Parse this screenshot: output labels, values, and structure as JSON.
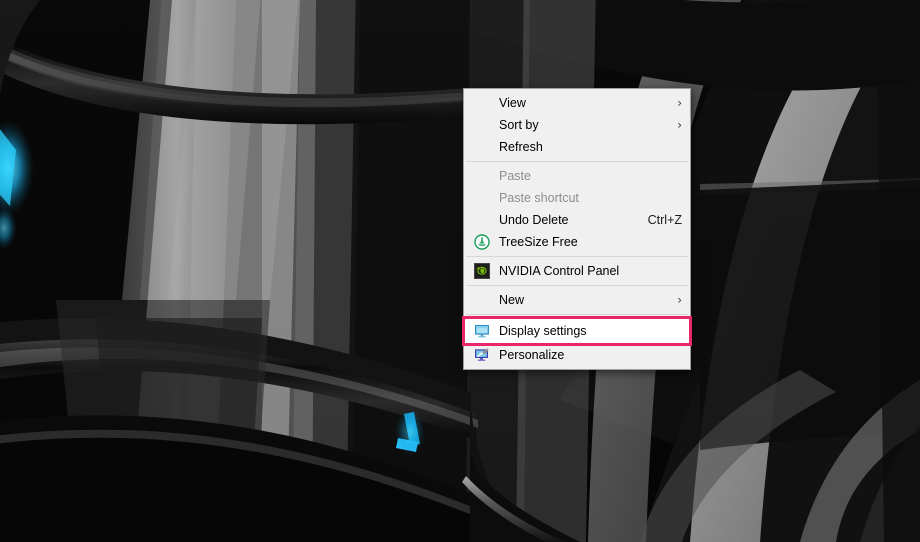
{
  "desktop": {
    "name": "windows-desktop",
    "wallpaper_description": "abstract dark glossy curved panels with gray bands and cyan edge glow",
    "colors": {
      "bg_black": "#050505",
      "panel_dark": "#141414",
      "panel_mid": "#3a3a3a",
      "panel_light": "#9a9a9a",
      "panel_lighter": "#c9c9c9",
      "cyan_accent": "#14b4e8",
      "cyan_glow": "#29d2ff"
    }
  },
  "context_menu": {
    "name": "desktop-context-menu",
    "background": "#f0f0f0",
    "border": "#9e9e9e",
    "highlight_color": "#e8266b",
    "items": [
      {
        "id": "view",
        "label": "View",
        "icon": "",
        "accel": "",
        "submenu": true,
        "disabled": false,
        "highlighted": false
      },
      {
        "id": "sort-by",
        "label": "Sort by",
        "icon": "",
        "accel": "",
        "submenu": true,
        "disabled": false,
        "highlighted": false
      },
      {
        "id": "refresh",
        "label": "Refresh",
        "icon": "",
        "accel": "",
        "submenu": false,
        "disabled": false,
        "highlighted": false
      },
      {
        "id": "separator-1",
        "label": "",
        "icon": "",
        "accel": "",
        "submenu": false,
        "disabled": false,
        "highlighted": false
      },
      {
        "id": "paste",
        "label": "Paste",
        "icon": "",
        "accel": "",
        "submenu": false,
        "disabled": true,
        "highlighted": false
      },
      {
        "id": "paste-shortcut",
        "label": "Paste shortcut",
        "icon": "",
        "accel": "",
        "submenu": false,
        "disabled": true,
        "highlighted": false
      },
      {
        "id": "undo-delete",
        "label": "Undo Delete",
        "icon": "",
        "accel": "Ctrl+Z",
        "submenu": false,
        "disabled": false,
        "highlighted": false
      },
      {
        "id": "treesize-free",
        "label": "TreeSize Free",
        "icon": "treesize-icon",
        "accel": "",
        "submenu": false,
        "disabled": false,
        "highlighted": false
      },
      {
        "id": "separator-2",
        "label": "",
        "icon": "",
        "accel": "",
        "submenu": false,
        "disabled": false,
        "highlighted": false
      },
      {
        "id": "nvidia-control-panel",
        "label": "NVIDIA Control Panel",
        "icon": "nvidia-icon",
        "accel": "",
        "submenu": false,
        "disabled": false,
        "highlighted": false
      },
      {
        "id": "separator-3",
        "label": "",
        "icon": "",
        "accel": "",
        "submenu": false,
        "disabled": false,
        "highlighted": false
      },
      {
        "id": "new",
        "label": "New",
        "icon": "",
        "accel": "",
        "submenu": true,
        "disabled": false,
        "highlighted": false
      },
      {
        "id": "separator-4",
        "label": "",
        "icon": "",
        "accel": "",
        "submenu": false,
        "disabled": false,
        "highlighted": false
      },
      {
        "id": "display-settings",
        "label": "Display settings",
        "icon": "monitor-icon",
        "accel": "",
        "submenu": false,
        "disabled": false,
        "highlighted": true
      },
      {
        "id": "personalize",
        "label": "Personalize",
        "icon": "personalize-icon",
        "accel": "",
        "submenu": false,
        "disabled": false,
        "highlighted": false
      }
    ],
    "submenu_glyph": "›"
  }
}
